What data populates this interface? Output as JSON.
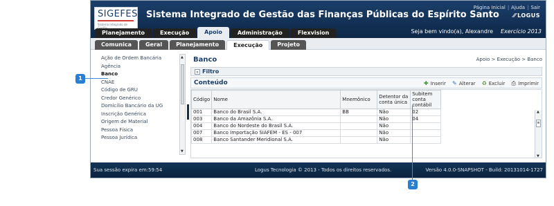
{
  "header": {
    "logo_text": "SIGEFES",
    "logo_sub": "Sistema Integrado de Gestão",
    "title": "Sistema Integrado de Gestão das Finanças Públicas do Espírito Santo",
    "links": [
      "Página Inicial",
      "Ajuda",
      "Sair"
    ],
    "brand": "LOGUS",
    "welcome": "Seja bem vindo(a), Alexandre",
    "exercicio": "Exercício 2013"
  },
  "main_tabs": [
    "Planejamento",
    "Execução",
    "Apoio",
    "Administração",
    "Flexvision"
  ],
  "main_tabs_active": "Apoio",
  "sub_tabs": [
    "Comunica",
    "Geral",
    "Planejamento",
    "Execução",
    "Projeto"
  ],
  "sub_tabs_active": "Execução",
  "sidebar": {
    "items": [
      "Ação de Ordem Bancária",
      "Agência",
      "Banco",
      "CNAE",
      "Código de GRU",
      "Credor Genérico",
      "Domicílio Bancário da UG",
      "Inscrição Genérica",
      "Origem de Material",
      "Pessoa Física",
      "Pessoa Jurídica"
    ],
    "active": "Banco"
  },
  "content": {
    "title": "Banco",
    "breadcrumb": "Apoio > Execução > Banco",
    "filtro_label": "Filtro",
    "filtro_toggle": "»",
    "conteudo_label": "Conteúdo",
    "actions": {
      "inserir": "Inserir",
      "alterar": "Alterar",
      "excluir": "Excluir",
      "imprimir": "Imprimir"
    }
  },
  "table": {
    "headers": {
      "codigo": "Código",
      "nome": "Nome",
      "mnemonico": "Mnemônico",
      "detentor": "Detentor da conta única",
      "subitem": "Subitem conta contábil"
    },
    "rows": [
      [
        "001",
        "Banco do Brasil S.A.",
        "BB",
        "Não",
        "02"
      ],
      [
        "003",
        "Banco da Amazônia S.A.",
        "",
        "Não",
        "04"
      ],
      [
        "004",
        "Banco do Nordeste do Brasil S.A.",
        "",
        "Não",
        ""
      ],
      [
        "007",
        "Banco Importação SIAFEM - ES - 007",
        "",
        "Não",
        ""
      ],
      [
        "008",
        "Banco Santander Meridional S.A.",
        "",
        "Não",
        ""
      ]
    ]
  },
  "footer": {
    "session": "Sua sessão expira em:59:54",
    "copyright": "Logus Tecnologia © 2013 - Todos os direitos reservados.",
    "version": "Versão 4.0.0-SNAPSHOT - Build: 20131014-1727"
  },
  "callouts": [
    "1",
    "2"
  ],
  "colors": {
    "header_bg": "#1b3f6a",
    "accent": "#2a7fd0",
    "title_text": "#1b3f6a"
  }
}
